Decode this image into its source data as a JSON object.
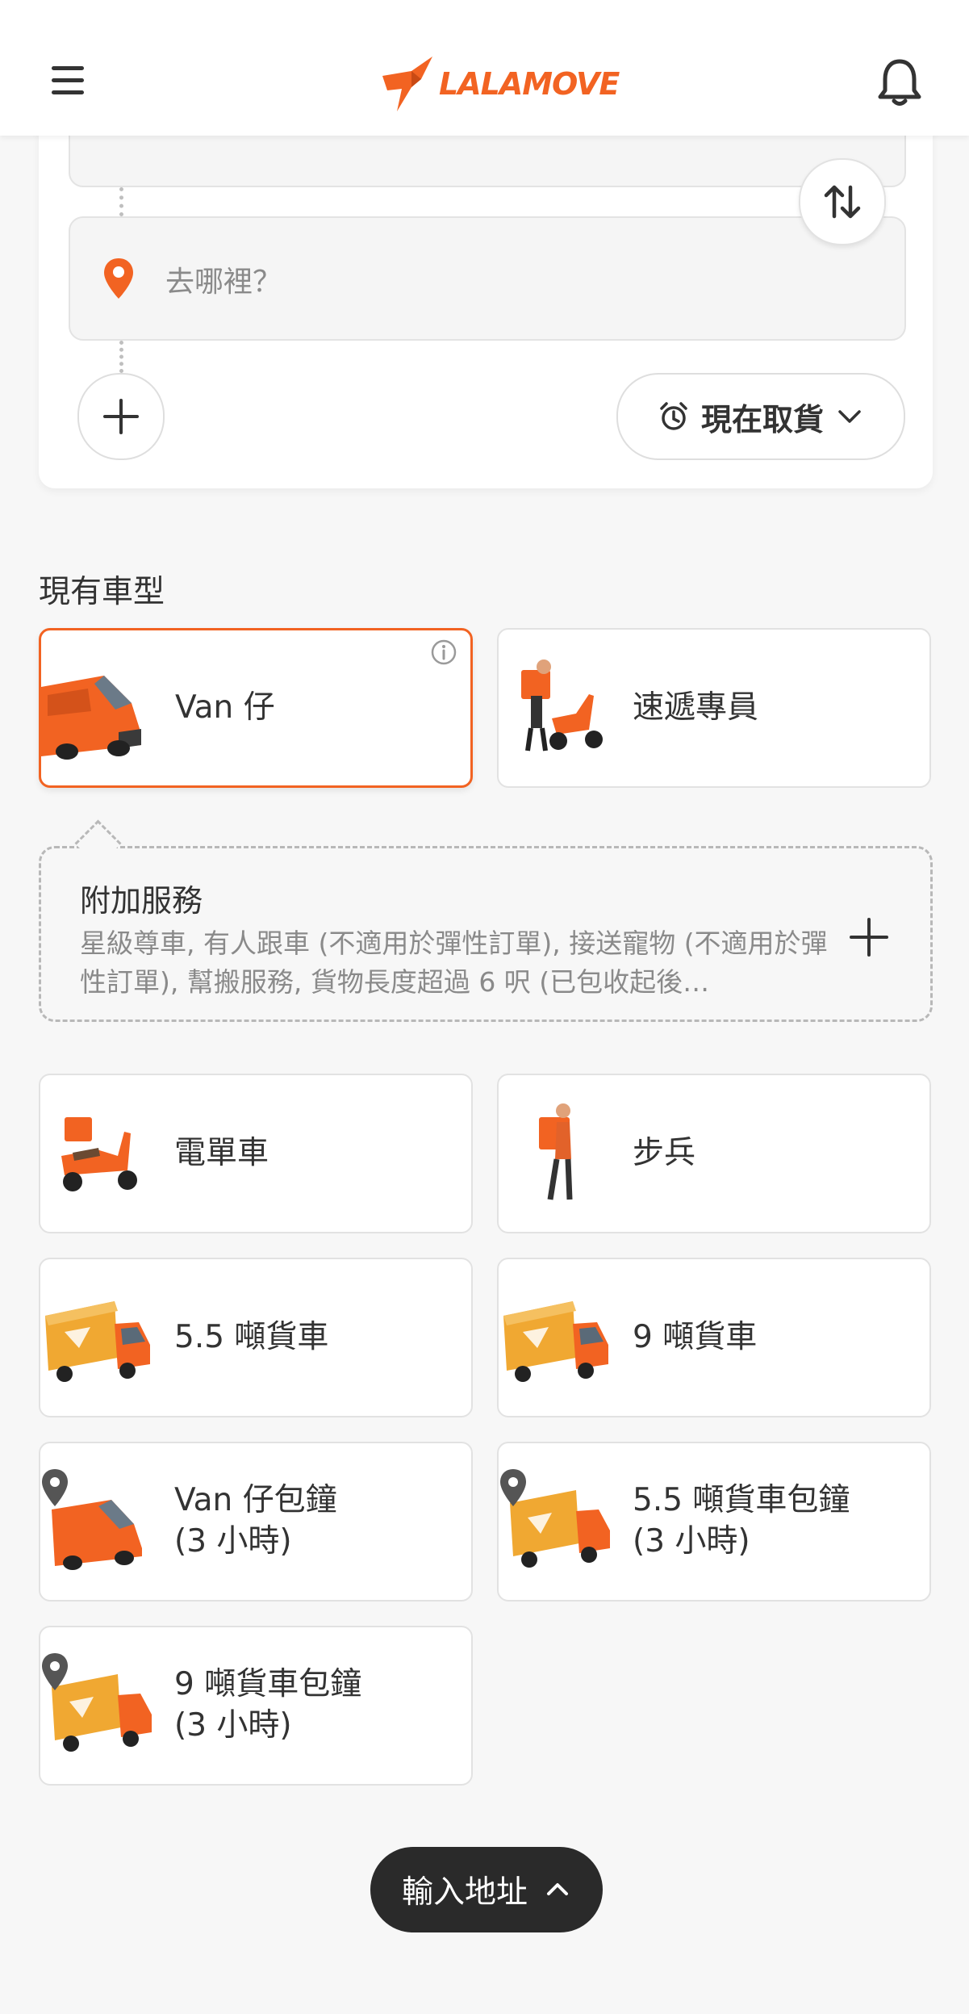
{
  "header": {
    "logo_text": "LALAMOVE",
    "menu_icon": "hamburger-menu-icon",
    "bell_icon": "bell-icon",
    "brand_color": "#f26322"
  },
  "route": {
    "destination_placeholder": "去哪裡？",
    "pickup_time_label": "現在取貨",
    "icons": [
      "location-pin-icon",
      "swap-icon",
      "plus-icon",
      "alarm-clock-icon",
      "chevron-down-icon"
    ]
  },
  "vehicles": {
    "section_title": "現有車型",
    "van": "Van 仔",
    "courier": "速遞專員",
    "ebike": "電單車",
    "walker": "步兵",
    "truck55": "5.5 噸貨車",
    "truck9": "9 噸貨車",
    "van_hourly": [
      "Van 仔包鐘",
      "(3 小時)"
    ],
    "truck55_hourly": [
      "5.5 噸貨車包鐘",
      "(3 小時)"
    ],
    "truck9_hourly": [
      "9 噸貨車包鐘",
      "(3 小時)"
    ]
  },
  "addon": {
    "title": "附加服務",
    "description": "星級尊車, 有人跟車 (不適用於彈性訂單), 接送寵物 (不適用於彈性訂單), 幫搬服務, 貨物長度超過 6 呎 (已包收起後…"
  },
  "cta": {
    "label": "輸入地址"
  }
}
